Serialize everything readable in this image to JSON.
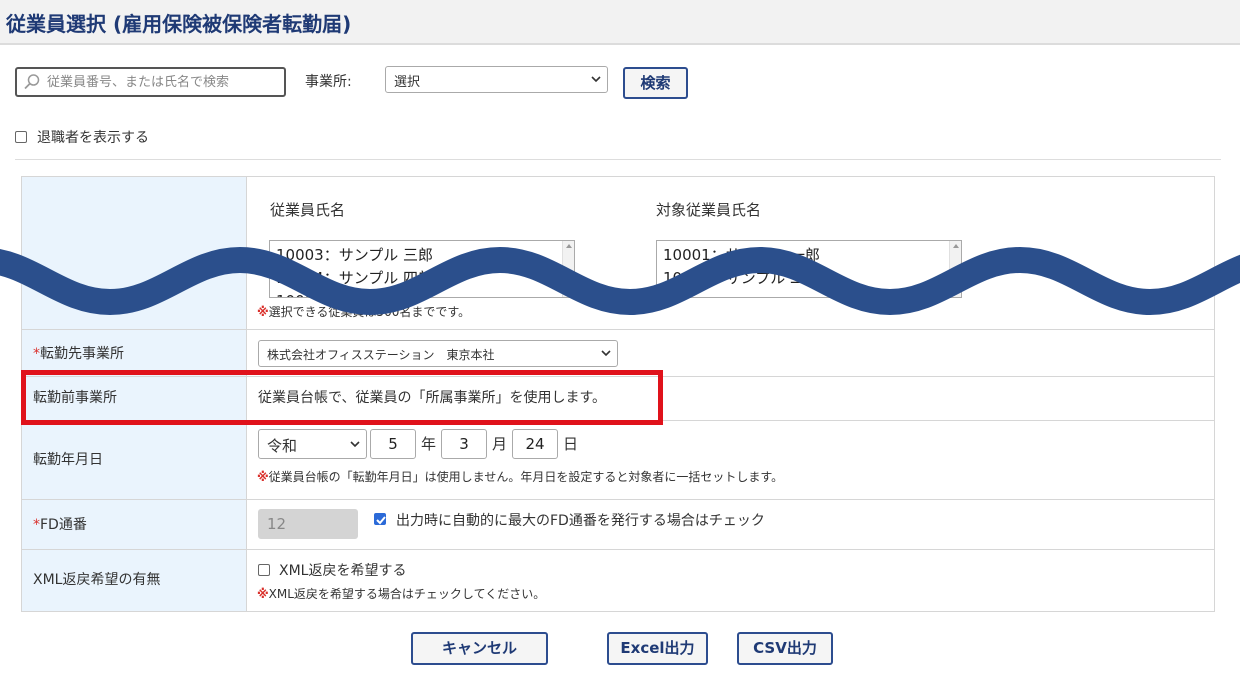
{
  "header": {
    "title": "従業員選択 (雇用保険被保険者転勤届)"
  },
  "search": {
    "placeholder": "従業員番号、または氏名で検索",
    "value": ""
  },
  "filter": {
    "office_label": "事業所:",
    "office_selected": "選択",
    "search_button": "検索"
  },
  "retired": {
    "label": "退職者を表示する",
    "checked": false
  },
  "employees": {
    "left_header": "従業員氏名",
    "left_items": [
      "10003：サンプル 三郎",
      "10004：サンプル 四郎",
      "10005：サンプル 五郎"
    ],
    "right_header": "対象従業員氏名",
    "right_items": [
      "10001：サンプル 一郎",
      "10002：サンプル 二郎"
    ],
    "note_mark": "※",
    "note": "選択できる従業員は500名までです。"
  },
  "destination": {
    "req": "*",
    "label": "転勤先事業所",
    "selected": "株式会社オフィスステーション　東京本社"
  },
  "origin": {
    "label": "転勤前事業所",
    "text": "従業員台帳で、従業員の「所属事業所」を使用します。"
  },
  "date": {
    "label": "転勤年月日",
    "era": "令和",
    "year": "5",
    "year_unit": "年",
    "month": "3",
    "month_unit": "月",
    "day": "24",
    "day_unit": "日",
    "note_mark": "※",
    "note": "従業員台帳の「転勤年月日」は使用しません。年月日を設定すると対象者に一括セットします。"
  },
  "fd": {
    "req": "*",
    "label": "FD通番",
    "value": "12",
    "auto_checked": true,
    "auto_label": "出力時に自動的に最大のFD通番を発行する場合はチェック"
  },
  "xml": {
    "label": "XML返戻希望の有無",
    "checkbox_label": "XML返戻を希望する",
    "checked": false,
    "note_mark": "※",
    "note": "XML返戻を希望する場合はチェックしてください。"
  },
  "footer": {
    "cancel": "キャンセル",
    "excel": "Excel出力",
    "csv": "CSV出力"
  },
  "colors": {
    "title": "#1f3a75",
    "accent": "#2d4d8f",
    "label_bg": "#eaf4fd",
    "required": "#d9302b",
    "highlight": "#e0121b",
    "wave": "#2b4f8c"
  }
}
